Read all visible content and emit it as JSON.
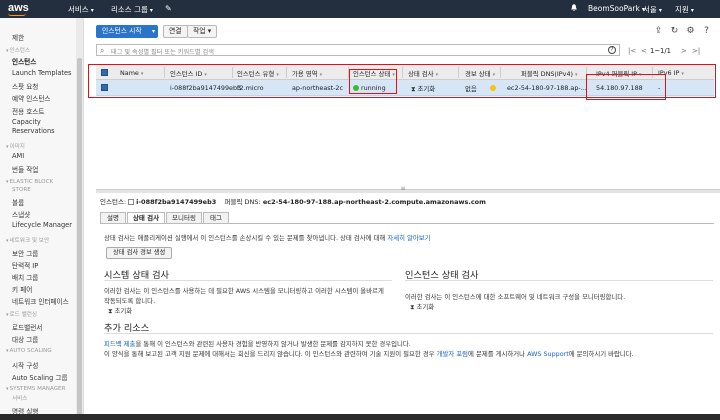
{
  "topnav": {
    "logo": "aws",
    "services": "서비스",
    "resource_groups": "리소스 그룹",
    "user": "BeomSooPark",
    "region": "서울",
    "support": "지원"
  },
  "sidebar": {
    "items": [
      {
        "type": "item",
        "label": "제한"
      },
      {
        "type": "head",
        "label": "인스턴스"
      },
      {
        "type": "item",
        "label": "인스턴스",
        "active": true
      },
      {
        "type": "item",
        "label": "Launch Templates"
      },
      {
        "type": "item",
        "label": "스팟 요청"
      },
      {
        "type": "item",
        "label": "예약 인스턴스"
      },
      {
        "type": "item",
        "label": "전용 호스트"
      },
      {
        "type": "item",
        "label": "Capacity"
      },
      {
        "type": "item",
        "label": "Reservations"
      },
      {
        "type": "head",
        "label": "이미지"
      },
      {
        "type": "item",
        "label": "AMI"
      },
      {
        "type": "item",
        "label": "번들 작업"
      },
      {
        "type": "head",
        "label": "ELASTIC BLOCK"
      },
      {
        "type": "head2",
        "label": "STORE"
      },
      {
        "type": "item",
        "label": "볼륨"
      },
      {
        "type": "item",
        "label": "스냅샷"
      },
      {
        "type": "item",
        "label": "Lifecycle Manager"
      },
      {
        "type": "head",
        "label": "네트워크 및 보안"
      },
      {
        "type": "item",
        "label": "보안 그룹"
      },
      {
        "type": "item",
        "label": "탄력적 IP"
      },
      {
        "type": "item",
        "label": "배치 그룹"
      },
      {
        "type": "item",
        "label": "키 페어"
      },
      {
        "type": "item",
        "label": "네트워크 인터페이스"
      },
      {
        "type": "head",
        "label": "로드 밸런싱"
      },
      {
        "type": "item",
        "label": "로드밸런서"
      },
      {
        "type": "item",
        "label": "대상 그룹"
      },
      {
        "type": "head",
        "label": "AUTO SCALING"
      },
      {
        "type": "item",
        "label": "시작 구성"
      },
      {
        "type": "item",
        "label": "Auto Scaling 그룹"
      },
      {
        "type": "head",
        "label": "SYSTEMS MANAGER"
      },
      {
        "type": "head2",
        "label": "서비스"
      },
      {
        "type": "item",
        "label": "명령 실행"
      }
    ]
  },
  "toolbar": {
    "launch_label": "인스턴스 시작",
    "connect_label": "연결",
    "actions_label": "작업"
  },
  "search": {
    "placeholder": "태그 및 속성별 필터 또는 키워드별 검색"
  },
  "pager": {
    "count": "1~1/1"
  },
  "table": {
    "headers": [
      "Name",
      "인스턴스 ID",
      "인스턴스 유형",
      "가용 영역",
      "인스턴스 상태",
      "상태 검사",
      "경보 상태",
      "퍼블릭 DNS(IPv4)",
      "IPv4 퍼블릭 IP",
      "IPv6 IP"
    ],
    "row": {
      "name": "",
      "instance_id": "i-088f2ba9147499eb3",
      "instance_type": "t2.micro",
      "az": "ap-northeast-2c",
      "state": "running",
      "status_check": "초기화",
      "alarm": "없음",
      "dns": "ec2-54-180-97-188.ap-...",
      "ipv4": "54.180.97.188",
      "ipv6": "-"
    }
  },
  "detail": {
    "instance_label": "인스턴스:",
    "instance_id": "i-088f2ba9147499eb3",
    "dns_label": "퍼블릭 DNS:",
    "dns": "ec2-54-180-97-188.ap-northeast-2.compute.amazonaws.com",
    "tabs": [
      "설명",
      "상태 검사",
      "모니터링",
      "태그"
    ],
    "intro": "상태 검사는 애플리케이션 실행에서 이 인스턴스를 손상시킬 수 있는 문제를 찾아냅니다. 상태 검사에 대해",
    "intro_link": "자세히 알아보기",
    "report_button": "상태 검사 경보 생성",
    "system_title": "시스템 상태 검사",
    "system_desc1": "이러한 검사는 이 인스턴스를 사용하는 데 필요한 AWS 시스템을 모니터링하고 이러한 시스템이 올바르게",
    "system_desc2": "작동되도록 합니다.",
    "system_status": "초기화",
    "instance_title": "인스턴스 상태 검사",
    "instance_desc": "이러한 검사는 이 인스턴스에 대한 소프트웨어 및 네트워크 구성을 모니터링합니다.",
    "instance_status": "초기화",
    "extra_title": "추가 리소스",
    "extra_link1": "피드백 제출",
    "extra_text1": "을 통해 이 인스턴스와 관련된 사용자 경험을 반영하지 않거나 발생한 문제를 감지하지 못한 경우입니다.",
    "extra_text2": "이 양식을 통해 보고된 고객 지원 문제에 대해서는 회신을 드리지 않습니다. 이 인스턴스와 관련하여 기술 지원이 필요한 경우",
    "extra_link2": "개발자 포럼",
    "extra_text3": "에 문제를 게시하거나",
    "extra_link3": "AWS Support",
    "extra_text4": "에 문의하시기 바랍니다."
  },
  "colors": {
    "nav_bg": "#232f3e",
    "primary": "#2a75c7",
    "highlight_box": "#e3101a",
    "running": "#3fb829"
  }
}
